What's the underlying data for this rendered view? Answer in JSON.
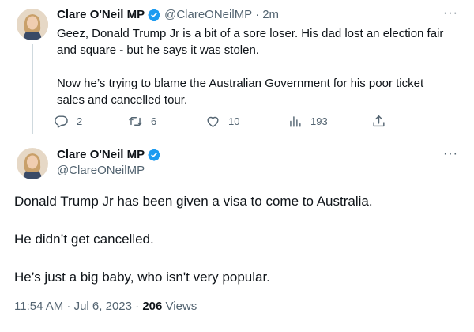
{
  "first_tweet": {
    "author_name": "Clare O'Neil MP",
    "handle": "@ClareONeilMP",
    "separator": "·",
    "time": "2m",
    "more": "···",
    "paragraphs": [
      "Geez, Donald Trump Jr is a bit of a sore loser. His dad lost an election fair and square - but he says it was stolen.",
      "Now he’s trying to blame the Australian Government for his poor ticket sales and cancelled tour."
    ],
    "actions": {
      "replies": "2",
      "retweets": "6",
      "likes": "10",
      "views": "193"
    }
  },
  "second_tweet": {
    "author_name": "Clare O'Neil MP",
    "handle": "@ClareONeilMP",
    "more": "···",
    "paragraphs": [
      "Donald Trump Jr has been given a visa to come to Australia.",
      "He didn’t get cancelled.",
      "He’s just a big baby, who isn't very popular."
    ],
    "timestamp": "11:54 AM · Jul 6, 2023 ·",
    "views_count": "206",
    "views_label": "Views"
  },
  "colors": {
    "text": "#0f1419",
    "secondary": "#536471",
    "verified": "#1d9bf0",
    "thread_line": "#cfd9de"
  },
  "icons": [
    "verified-badge-icon",
    "more-icon",
    "reply-icon",
    "retweet-icon",
    "like-icon",
    "views-icon",
    "share-icon"
  ]
}
